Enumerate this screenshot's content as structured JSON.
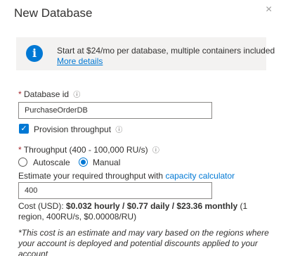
{
  "panel": {
    "title": "New Database",
    "close_icon": "×"
  },
  "info": {
    "icon": "i",
    "text": "Start at $24/mo per database, multiple containers included",
    "link": "More details"
  },
  "database_id": {
    "required_mark": "*",
    "label": "Database id",
    "info_icon": "ⓘ",
    "value": "PurchaseOrderDB"
  },
  "provision": {
    "checked": true,
    "label": "Provision throughput",
    "info_icon": "ⓘ"
  },
  "throughput": {
    "required_mark": "*",
    "label": "Throughput (400 - 100,000 RU/s)",
    "info_icon": "ⓘ",
    "options": [
      {
        "label": "Autoscale",
        "selected": false
      },
      {
        "label": "Manual",
        "selected": true
      }
    ],
    "estimate_text": "Estimate your required throughput with",
    "calculator_link": "capacity calculator",
    "value": "400"
  },
  "cost": {
    "prefix": "Cost (USD):",
    "amounts": "$0.032 hourly / $0.77 daily / $23.36 monthly",
    "details": "(1 region, 400RU/s, $0.00008/RU)"
  },
  "note": "*This cost is an estimate and may vary based on the regions where your account is deployed and potential discounts applied to your account"
}
